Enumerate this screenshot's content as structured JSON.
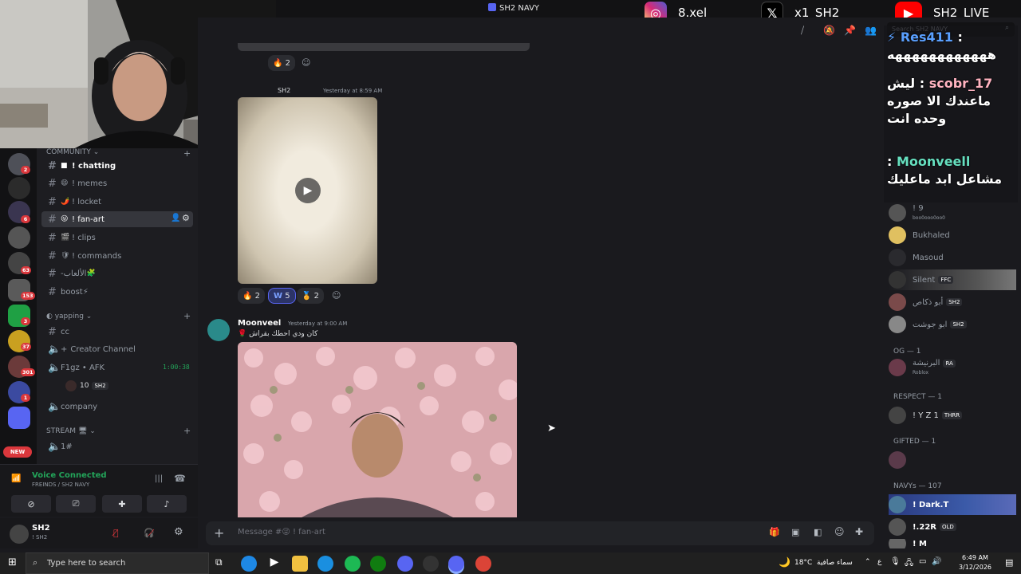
{
  "window": {
    "title": "SH2 NAVY"
  },
  "social": [
    {
      "icon": "instagram-icon",
      "handle": "8.xel",
      "color": "#d62976"
    },
    {
      "icon": "x-icon",
      "handle": "x1_SH2",
      "color": "#000000"
    },
    {
      "icon": "youtube-icon",
      "handle": "SH2_LIVE",
      "color": "#ff0000"
    }
  ],
  "search": {
    "placeholder": "Search SH2 NAVY"
  },
  "servers": {
    "badges": [
      "2",
      "6",
      "63",
      "153",
      "3",
      "37",
      "301",
      "1"
    ],
    "new_label": "NEW"
  },
  "channels": {
    "community_label": "COMMUNITY",
    "items": [
      {
        "name": "! chatting",
        "emoji": "■"
      },
      {
        "name": "! memes",
        "emoji": "😄"
      },
      {
        "name": "! locket",
        "emoji": "🌶️"
      },
      {
        "name": "! fan-art",
        "emoji": "😜"
      },
      {
        "name": "! clips",
        "emoji": "🎬"
      },
      {
        "name": "! commands",
        "emoji": "🛡"
      },
      {
        "name": "-الألعاب",
        "emoji": "🧩"
      },
      {
        "name": "boost⚡",
        "emoji": ""
      }
    ],
    "yapping_label": "yapping",
    "voice": [
      {
        "name": "cc"
      },
      {
        "name": "Creator Channel"
      },
      {
        "name": "F1gz • AFK",
        "time": "1:00:38"
      },
      {
        "name": "10",
        "tag": "SH2"
      },
      {
        "name": "company"
      }
    ],
    "stream_label": "STREAM",
    "stream_channel": "1#"
  },
  "voice_panel": {
    "status": "Voice Connected",
    "location": "FREINDS / SH2 NAVY"
  },
  "user": {
    "name": "SH2",
    "status": "! SH2"
  },
  "messages": {
    "top_reactions": [
      {
        "emoji": "🔥",
        "count": "2"
      }
    ],
    "msg1": {
      "timestamp": "Yesterday at 8:59 AM",
      "author_tag": "SH2",
      "reactions": [
        {
          "emoji": "🔥",
          "count": "2"
        },
        {
          "emoji": "W",
          "count": "5"
        },
        {
          "emoji": "🏅",
          "count": "2"
        }
      ]
    },
    "msg2": {
      "author": "Moonveel",
      "timestamp": "Yesterday at 9:00 AM",
      "text": "كان ودي احطك بقراش"
    }
  },
  "composer": {
    "placeholder": "Message #😜 ! fan-art"
  },
  "members": {
    "list": [
      {
        "name": "Bukhaled"
      },
      {
        "name": "Masoud"
      },
      {
        "name": "Silent",
        "tag": "FFC"
      },
      {
        "name": "أبو ذكاص",
        "tag": "SH2"
      },
      {
        "name": "ابو جوشت",
        "tag": "SH2"
      }
    ],
    "og_label": "OG — 1",
    "og_member": {
      "name": "البرنيشة",
      "tag": "RA",
      "activity": "Roblox"
    },
    "respect_label": "RESPECT — 1",
    "respect_member": {
      "name": "! Y Z 1",
      "tag": "THRR"
    },
    "gifted_label": "GIFTED — 1",
    "navys_label": "NAVYs — 107",
    "navys": [
      {
        "name": "! Dark.T"
      },
      {
        "name": "!.22R",
        "tag": "OLD"
      },
      {
        "name": "! M"
      }
    ],
    "hidden_member": {
      "name": "! 9",
      "activity": "boo0ooo0oo0"
    }
  },
  "overlay": {
    "lines": [
      {
        "user": "Res411",
        "text": "ههههههههههههه",
        "user_color": "#5aa0ff"
      },
      {
        "user": "scobr_17",
        "text": "ليش ماعندك الا صوره وحده انت",
        "user_color": "#ffb3c0"
      },
      {
        "user": "Moonveell",
        "text": "مشاعل ابد ماعليك",
        "user_color": "#66e0c0"
      }
    ]
  },
  "taskbar": {
    "search_placeholder": "Type here to search",
    "temp": "18°C",
    "weather": "سماء صافية",
    "time": "6:49 AM",
    "date": "3/12/2026",
    "lang": "ع"
  }
}
